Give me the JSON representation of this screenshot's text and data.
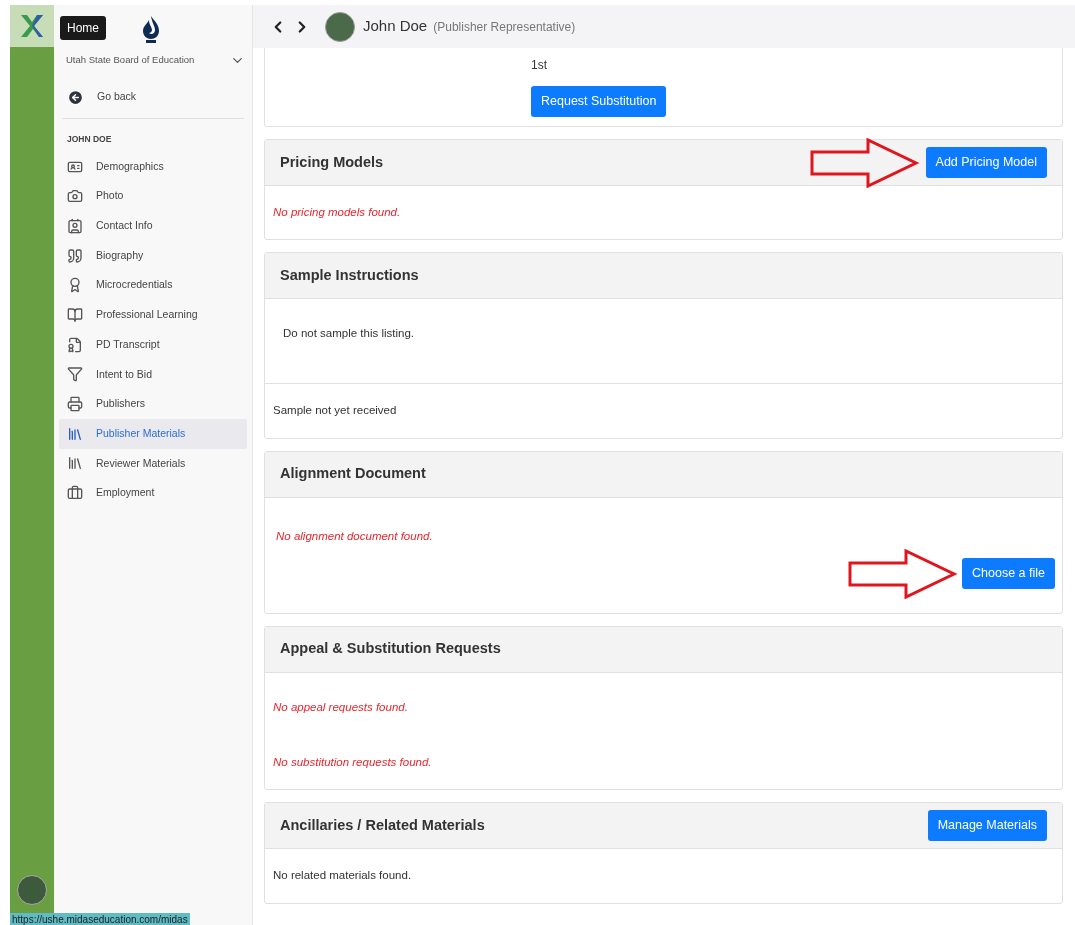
{
  "rail": {
    "tooltip": "Home",
    "status_url": "https://ushe.midaseducation.com/midas"
  },
  "sidebar": {
    "organization": "Utah State Board of Education",
    "back": "Go back",
    "section": "JOHN DOE",
    "items": [
      {
        "label": "Demographics",
        "selected": false
      },
      {
        "label": "Photo",
        "selected": false
      },
      {
        "label": "Contact Info",
        "selected": false
      },
      {
        "label": "Biography",
        "selected": false
      },
      {
        "label": "Microcredentials",
        "selected": false
      },
      {
        "label": "Professional Learning",
        "selected": false
      },
      {
        "label": "PD Transcript",
        "selected": false
      },
      {
        "label": "Intent to Bid",
        "selected": false
      },
      {
        "label": "Publishers",
        "selected": false
      },
      {
        "label": "Publisher Materials",
        "selected": true
      },
      {
        "label": "Reviewer Materials",
        "selected": false
      },
      {
        "label": "Employment",
        "selected": false
      }
    ]
  },
  "header": {
    "name": "John Doe",
    "role": "(Publisher Representative)"
  },
  "top_card": {
    "value": "1st",
    "button": "Request Substitution"
  },
  "sections": [
    {
      "title": "Pricing Models",
      "header_button": {
        "label": "Add Pricing Model",
        "arrow": true
      },
      "blocks": [
        {
          "items": [
            {
              "text": "No pricing models found.",
              "kind": "empty"
            }
          ]
        }
      ]
    },
    {
      "title": "Sample Instructions",
      "blocks": [
        {
          "items": [
            {
              "text": "Do not sample this listing.",
              "kind": "plain"
            }
          ]
        },
        {
          "items": [
            {
              "text": "Sample not yet received",
              "kind": "plain"
            }
          ]
        }
      ]
    },
    {
      "title": "Alignment Document",
      "blocks": [
        {
          "items": [
            {
              "text": "No alignment document found.",
              "kind": "empty"
            }
          ],
          "button": {
            "label": "Choose a file",
            "arrow": true
          }
        }
      ]
    },
    {
      "title": "Appeal & Substitution Requests",
      "blocks": [
        {
          "items": [
            {
              "text": "No appeal requests found.",
              "kind": "empty"
            },
            {
              "text": "No substitution requests found.",
              "kind": "empty"
            }
          ]
        }
      ]
    },
    {
      "title": "Ancillaries / Related Materials",
      "header_button": {
        "label": "Manage Materials",
        "arrow": false
      },
      "blocks": [
        {
          "items": [
            {
              "text": "No related materials found.",
              "kind": "plain"
            }
          ]
        }
      ]
    }
  ]
}
